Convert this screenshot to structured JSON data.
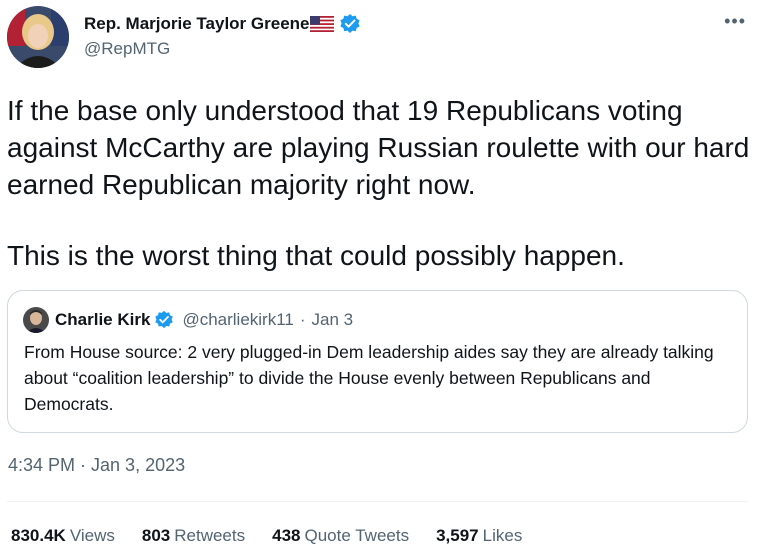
{
  "author": {
    "name": "Rep. Marjorie Taylor Greene",
    "handle": "@RepMTG"
  },
  "tweet": {
    "paragraphs": [
      "If the base only understood that 19 Republicans voting against McCarthy are playing Russian roulette with our hard earned Republican majority right now.",
      "This is the worst thing that could possibly happen."
    ],
    "timestamp": "4:34 PM · Jan 3, 2023"
  },
  "quote": {
    "name": "Charlie Kirk",
    "handle": "@charliekirk11",
    "separator": "·",
    "date": "Jan 3",
    "text": "From House source: 2 very plugged-in Dem leadership aides say they are already talking about “coalition leadership” to divide the House evenly between Republicans and Democrats."
  },
  "stats": [
    {
      "value": "830.4K",
      "label": "Views"
    },
    {
      "value": "803",
      "label": "Retweets"
    },
    {
      "value": "438",
      "label": "Quote Tweets"
    },
    {
      "value": "3,597",
      "label": "Likes"
    }
  ],
  "icons": {
    "verified": "verified-badge-icon",
    "flag": "us-flag-icon",
    "more": "more-options-icon"
  },
  "colors": {
    "verified_blue": "#1d9bf0",
    "secondary_text": "#536471",
    "primary_text": "#0f1419",
    "border": "#cfd9de"
  }
}
